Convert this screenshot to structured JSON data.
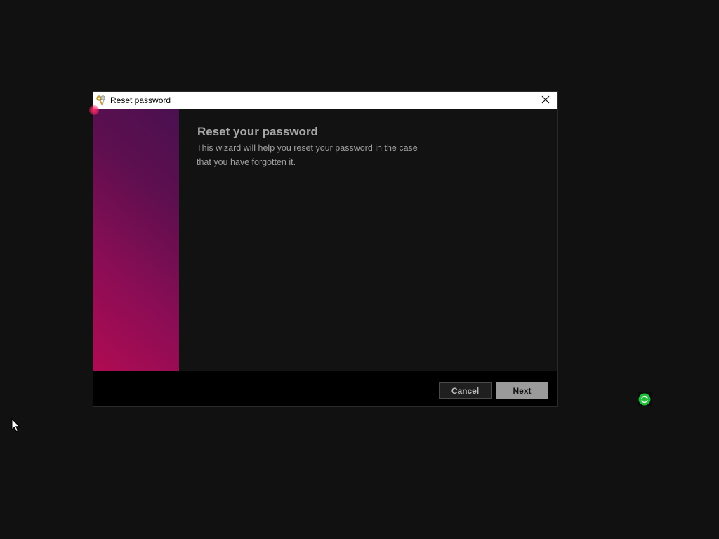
{
  "dialog": {
    "title": "Reset password",
    "heading": "Reset your password",
    "description_line1": "This wizard will help you reset your password in the case",
    "description_line2": "that you have forgotten it.",
    "close_label": "Close",
    "cancel_label": "Cancel",
    "next_label": "Next"
  },
  "icons": {
    "title_icon": "keys-icon",
    "close_icon": "close-icon",
    "tray_icon": "sync-icon",
    "cursor": "mouse-pointer"
  },
  "colors": {
    "desktop_bg": "#111111",
    "banner_start": "#b00b52",
    "banner_end": "#4a1050",
    "next_button": "#9a9a9a",
    "tray_accent": "#1fbf3a"
  }
}
